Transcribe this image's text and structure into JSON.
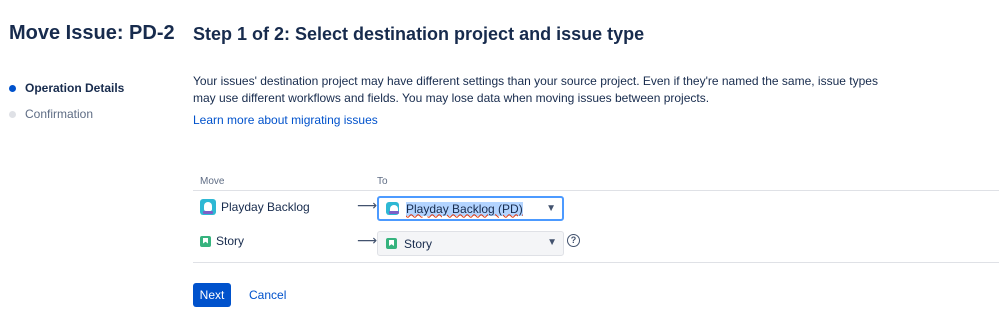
{
  "sidebar": {
    "title": "Move Issue: PD-2",
    "steps": [
      {
        "label": "Operation Details",
        "state": "active"
      },
      {
        "label": "Confirmation",
        "state": "inactive"
      }
    ]
  },
  "main": {
    "title": "Step 1 of 2: Select destination project and issue type",
    "description": "Your issues' destination project may have different settings than your source project. Even if they're named the same, issue types may use different workflows and fields. You may lose data when moving issues between projects.",
    "learn_more": "Learn more about migrating issues",
    "table": {
      "headers": {
        "move": "Move",
        "to": "To"
      },
      "rows": [
        {
          "source": "Playday Backlog",
          "source_icon": "project-avatar-icon",
          "arrow": "⟶",
          "target": "Playday Backlog (PD)",
          "target_icon": "project-avatar-icon"
        },
        {
          "source": "Story",
          "source_icon": "story-icon",
          "arrow": "⟶",
          "target": "Story",
          "target_icon": "story-icon"
        }
      ]
    }
  },
  "actions": {
    "next": "Next",
    "cancel": "Cancel"
  },
  "colors": {
    "primary": "#0052cc",
    "focus_ring": "#4c9aff",
    "story_green": "#36b37e",
    "project_teal": "#2eb8d4"
  }
}
